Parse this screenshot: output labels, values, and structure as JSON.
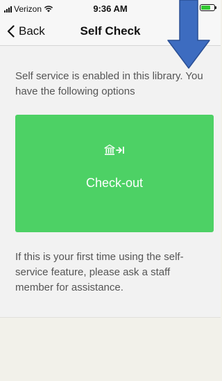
{
  "status_bar": {
    "carrier": "Verizon",
    "time": "9:36 AM",
    "battery_level": 0.7,
    "battery_color": "#32c832"
  },
  "nav": {
    "back_label": "Back",
    "title": "Self Check"
  },
  "main": {
    "intro": "Self service is enabled in this library. You have the following options",
    "options": [
      {
        "label": "Check-out",
        "icon": "library-checkout-icon",
        "color": "#4dd165"
      }
    ],
    "help": "If this is your first time using the self-service feature, please ask a staff member for assistance."
  },
  "overlay": {
    "arrow": "down-arrow-annotation",
    "arrow_color": "#3d6cc0"
  }
}
